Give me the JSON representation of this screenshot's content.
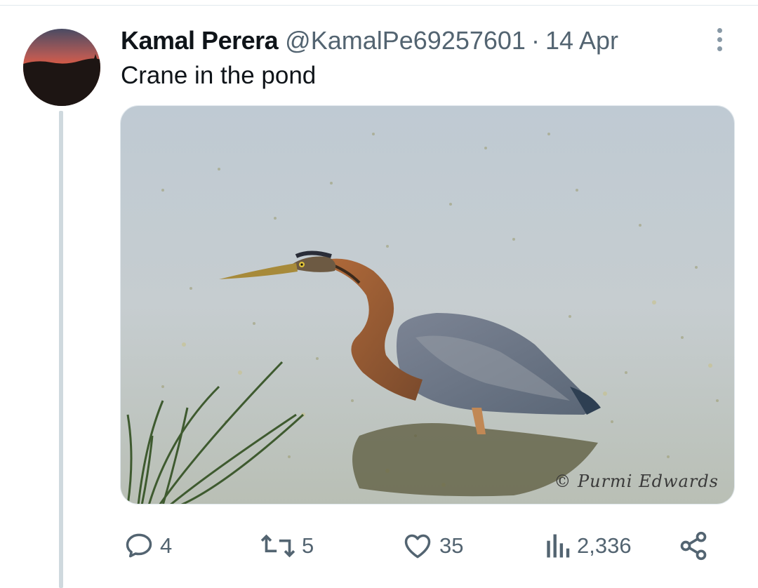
{
  "tweet": {
    "author_name": "Kamal Perera",
    "handle": "@KamalPe69257601",
    "separator": "·",
    "date": "14 Apr",
    "text": "Crane in the pond"
  },
  "media": {
    "watermark": "© Purmi Edwards",
    "subject_icon": "heron-photo"
  },
  "actions": {
    "replies": "4",
    "reposts": "5",
    "likes": "35",
    "views": "2,336"
  },
  "colors": {
    "text_primary": "#0f1419",
    "text_secondary": "#536471",
    "divider": "#cfd9de"
  }
}
